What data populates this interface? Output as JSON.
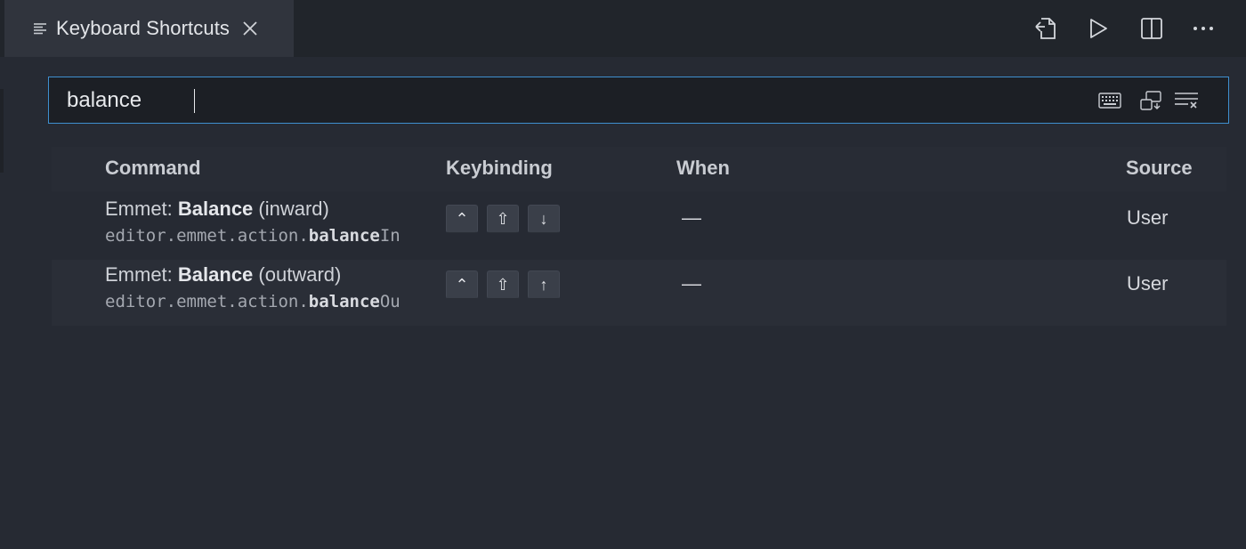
{
  "tab": {
    "title": "Keyboard Shortcuts",
    "icon": "list-icon",
    "close_icon": "close-icon"
  },
  "actions": [
    {
      "name": "open-json-icon"
    },
    {
      "name": "run-icon"
    },
    {
      "name": "split-editor-icon"
    },
    {
      "name": "more-icon"
    }
  ],
  "search": {
    "value": "balance",
    "buttons": [
      "record-keys-icon",
      "sort-by-precedence-icon",
      "clear-input-icon"
    ]
  },
  "table": {
    "headers": {
      "command": "Command",
      "keybinding": "Keybinding",
      "when": "When",
      "source": "Source"
    },
    "rows": [
      {
        "prefix": "Emmet: ",
        "bold": "Balance",
        "suffix": " (inward)",
        "id_prefix": "editor.emmet.action.",
        "id_bold": "balance",
        "id_suffix": "In",
        "keys": [
          "⌃",
          "⇧",
          "↓"
        ],
        "when": "—",
        "source": "User"
      },
      {
        "prefix": "Emmet: ",
        "bold": "Balance",
        "suffix": " (outward)",
        "id_prefix": "editor.emmet.action.",
        "id_bold": "balance",
        "id_suffix": "Ou",
        "keys": [
          "⌃",
          "⇧",
          "↑"
        ],
        "when": "—",
        "source": "User"
      }
    ]
  },
  "colors": {
    "background": "#262a33",
    "tabbar": "#21252b",
    "focus_border": "#3e8fcf"
  }
}
